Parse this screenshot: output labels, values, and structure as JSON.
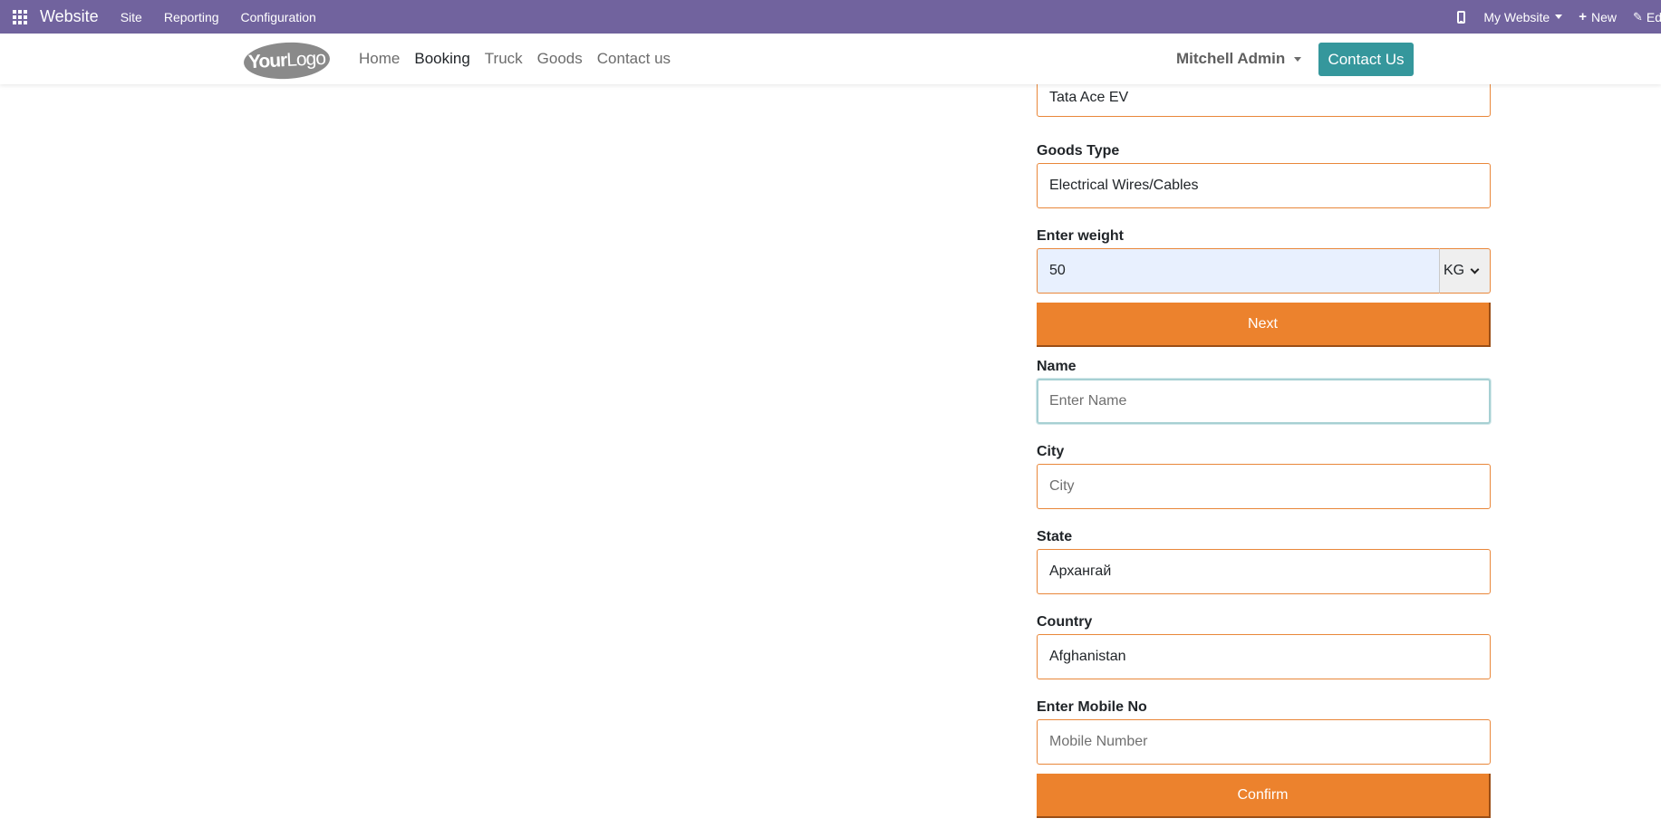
{
  "admin_bar": {
    "brand": "Website",
    "menu": [
      "Site",
      "Reporting",
      "Configuration"
    ],
    "website_selector": "My Website",
    "new_label": "New",
    "edit_label": "Edit",
    "background_color": "#71639e"
  },
  "header": {
    "logo_text_bold": "Your",
    "logo_text_light": "Logo",
    "nav": [
      "Home",
      "Booking",
      "Truck",
      "Goods",
      "Contact us"
    ],
    "active_nav": "Booking",
    "user_name": "Mitchell Admin",
    "contact_button": "Contact Us",
    "contact_button_color": "#35979c"
  },
  "form": {
    "truck_value": "Tata Ace EV",
    "goods_type": {
      "label": "Goods Type",
      "value": "Electrical Wires/Cables"
    },
    "weight": {
      "label": "Enter weight",
      "value": "50",
      "unit": "KG"
    },
    "next_button": "Next",
    "name": {
      "label": "Name",
      "placeholder": "Enter Name"
    },
    "city": {
      "label": "City",
      "placeholder": "City"
    },
    "state": {
      "label": "State",
      "value": "Архангай"
    },
    "country": {
      "label": "Country",
      "value": "Afghanistan"
    },
    "mobile": {
      "label": "Enter Mobile No",
      "placeholder": "Mobile Number"
    },
    "confirm_button": "Confirm",
    "accent_color": "#ec822d"
  }
}
